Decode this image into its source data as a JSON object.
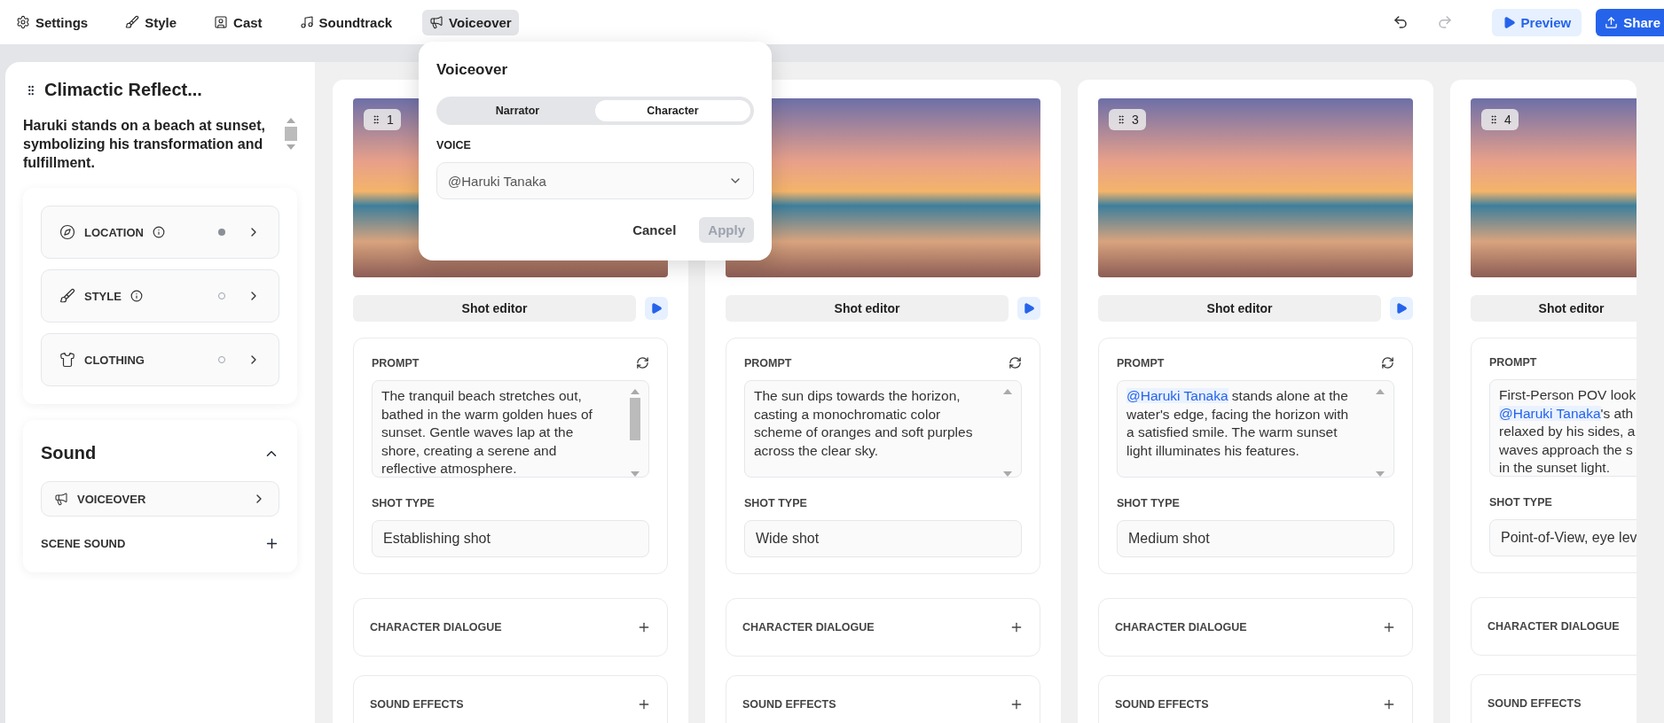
{
  "toolbar": {
    "tabs": [
      {
        "label": "Settings",
        "selected": false
      },
      {
        "label": "Style",
        "selected": false
      },
      {
        "label": "Cast",
        "selected": false
      },
      {
        "label": "Soundtrack",
        "selected": false
      },
      {
        "label": "Voiceover",
        "selected": true
      }
    ],
    "undo": {
      "disabled": false
    },
    "redo": {
      "disabled": true
    },
    "preview": "Preview",
    "share": "Share"
  },
  "sidebar": {
    "title": "Climactic Reflect...",
    "description": "Haruki stands on a beach at sunset, symbolizing his transformation and fulfillment.",
    "items": [
      {
        "label": "LOCATION",
        "info": true,
        "filled": true
      },
      {
        "label": "STYLE",
        "info": true,
        "filled": false
      },
      {
        "label": "CLOTHING",
        "info": false,
        "filled": false
      }
    ],
    "sound": {
      "title": "Sound",
      "expanded": true,
      "voiceover": "VOICEOVER",
      "scene_sound": "SCENE SOUND"
    }
  },
  "shots": [
    {
      "number": "1",
      "editor": "Shot editor",
      "play": true,
      "prompt_label": "PROMPT",
      "refresh": true,
      "scrollbar": true,
      "scroll_thumb": true,
      "prompt": [
        [
          {
            "kind": "plain",
            "text": "The tranquil beach stretches out,"
          }
        ],
        [
          {
            "kind": "plain",
            "text": "bathed in the warm golden hues of"
          }
        ],
        [
          {
            "kind": "plain",
            "text": "sunset. Gentle waves lap at the"
          }
        ],
        [
          {
            "kind": "plain",
            "text": "shore, creating a serene and"
          }
        ],
        [
          {
            "kind": "plain",
            "text": "reflective atmosphere."
          }
        ]
      ],
      "shot_type_label": "SHOT TYPE",
      "shot_type": "Establishing shot",
      "dialogue": "CHARACTER DIALOGUE",
      "effects": "SOUND EFFECTS"
    },
    {
      "editor": "Shot editor",
      "play": true,
      "prompt_label": "PROMPT",
      "refresh": true,
      "scrollbar": true,
      "scroll_thumb": false,
      "prompt": [
        [
          {
            "kind": "plain",
            "text": "The sun dips towards the horizon,"
          }
        ],
        [
          {
            "kind": "plain",
            "text": "casting a monochromatic color"
          }
        ],
        [
          {
            "kind": "plain",
            "text": "scheme of oranges and soft purples"
          }
        ],
        [
          {
            "kind": "plain",
            "text": "across the clear sky."
          }
        ]
      ],
      "shot_type_label": "SHOT TYPE",
      "shot_type": "Wide shot",
      "dialogue": "CHARACTER DIALOGUE",
      "effects": "SOUND EFFECTS"
    },
    {
      "number": "3",
      "editor": "Shot editor",
      "play": true,
      "prompt_label": "PROMPT",
      "refresh": true,
      "scrollbar": true,
      "scroll_thumb": false,
      "prompt": [
        [
          {
            "kind": "mention",
            "text": "@Haruki Tanaka"
          },
          {
            "kind": "plain",
            "text": " stands alone at the"
          }
        ],
        [
          {
            "kind": "plain",
            "text": "water's edge, facing the horizon with"
          }
        ],
        [
          {
            "kind": "plain",
            "text": "a satisfied smile. The warm sunset"
          }
        ],
        [
          {
            "kind": "plain",
            "text": "light illuminates his features."
          }
        ]
      ],
      "shot_type_label": "SHOT TYPE",
      "shot_type": "Medium shot",
      "dialogue": "CHARACTER DIALOGUE",
      "effects": "SOUND EFFECTS"
    },
    {
      "number": "4",
      "editor": "Shot editor",
      "play": false,
      "prompt_label": "PROMPT",
      "refresh": false,
      "scrollbar": false,
      "prompt": [
        [
          {
            "kind": "plain",
            "text": "First-Person POV look"
          }
        ],
        [
          {
            "kind": "mention",
            "text": "@Haruki Tanaka"
          },
          {
            "kind": "plain",
            "text": "'s ath"
          }
        ],
        [
          {
            "kind": "plain",
            "text": "relaxed by his sides, a"
          }
        ],
        [
          {
            "kind": "plain",
            "text": "waves approach the s"
          }
        ],
        [
          {
            "kind": "plain",
            "text": "in the sunset light."
          }
        ]
      ],
      "shot_type_label": "SHOT TYPE",
      "shot_type": "Point-of-View, eye lev",
      "dialogue": "CHARACTER DIALOGUE",
      "effects": "SOUND EFFECTS"
    }
  ],
  "popover": {
    "title": "Voiceover",
    "options": [
      {
        "label": "Narrator",
        "selected": false
      },
      {
        "label": "Character",
        "selected": true
      }
    ],
    "voice_label": "VOICE",
    "voice": "@Haruki Tanaka",
    "cancel": "Cancel",
    "apply": "Apply",
    "apply_disabled": true
  }
}
